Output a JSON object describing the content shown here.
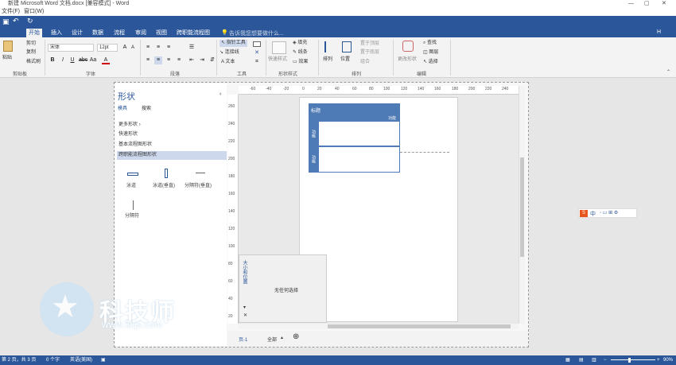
{
  "window": {
    "title": "新建 Microsoft Word 文档.docx [兼容模式] - Word"
  },
  "menu": {
    "items": [
      "文件(F)",
      "窗口(W)"
    ]
  },
  "tabs": [
    "开始",
    "插入",
    "设计",
    "数据",
    "流程",
    "审阅",
    "视图",
    "跨职能流程图"
  ],
  "search_placeholder": "告诉我您想要做什么...",
  "user": "H",
  "ribbon": {
    "clipboard": {
      "label": "剪贴板",
      "paste": "粘贴",
      "cut": "剪切",
      "copy": "复制",
      "format_painter": "格式刷"
    },
    "font": {
      "label": "字体",
      "font_name": "宋体",
      "font_size": "12pt"
    },
    "paragraph": {
      "label": "段落"
    },
    "tools": {
      "label": "工具",
      "pointer": "指针工具",
      "connector": "连接线",
      "text": "A 文本"
    },
    "shape_styles": {
      "label": "形状样式",
      "quick_styles": "快速样式",
      "fill": "填充",
      "line": "线条",
      "effects": "效果"
    },
    "arrange": {
      "label": "排列",
      "align": "排列",
      "position": "位置",
      "bring_forward": "置于顶层",
      "send_backward": "置于底层",
      "group": "组合"
    },
    "editing": {
      "label": "编辑",
      "change_shape": "更改形状",
      "find": "查找",
      "layers": "图层",
      "select": "选择"
    }
  },
  "shapes_panel": {
    "title": "形状",
    "tab_stencils": "模具",
    "tab_search": "搜索",
    "more_shapes": "更多形状",
    "items": [
      "快速形状",
      "基本流程图形状",
      "跨职能流程图形状"
    ],
    "selected_index": 2,
    "stencils": [
      "泳道",
      "泳道(垂直)",
      "分隔符(垂直)",
      "分隔符"
    ]
  },
  "ruler_top": [
    "-60",
    "-40",
    "-20",
    "0",
    "20",
    "40",
    "60",
    "80",
    "100",
    "120",
    "140",
    "160",
    "180",
    "200",
    "220",
    "240"
  ],
  "ruler_left": [
    "260",
    "240",
    "220",
    "200",
    "180",
    "160",
    "140",
    "120",
    "100",
    "80",
    "60",
    "40",
    "20"
  ],
  "diagram": {
    "header": "标题",
    "header_right": "功能",
    "lanes": [
      "功能",
      "功能"
    ]
  },
  "properties_panel": {
    "title": "大小和位置",
    "empty_text": "无任何选择"
  },
  "sheet_tabs": {
    "page": "页-1",
    "all": "全部"
  },
  "statusbar": {
    "pages": "第 2 页，共 3 页",
    "words": "0 个字",
    "language": "英语(美国)",
    "zoom": "90%"
  },
  "watermark": {
    "cn": "科技师",
    "url": "www.3kjs.com"
  },
  "ime": "中"
}
